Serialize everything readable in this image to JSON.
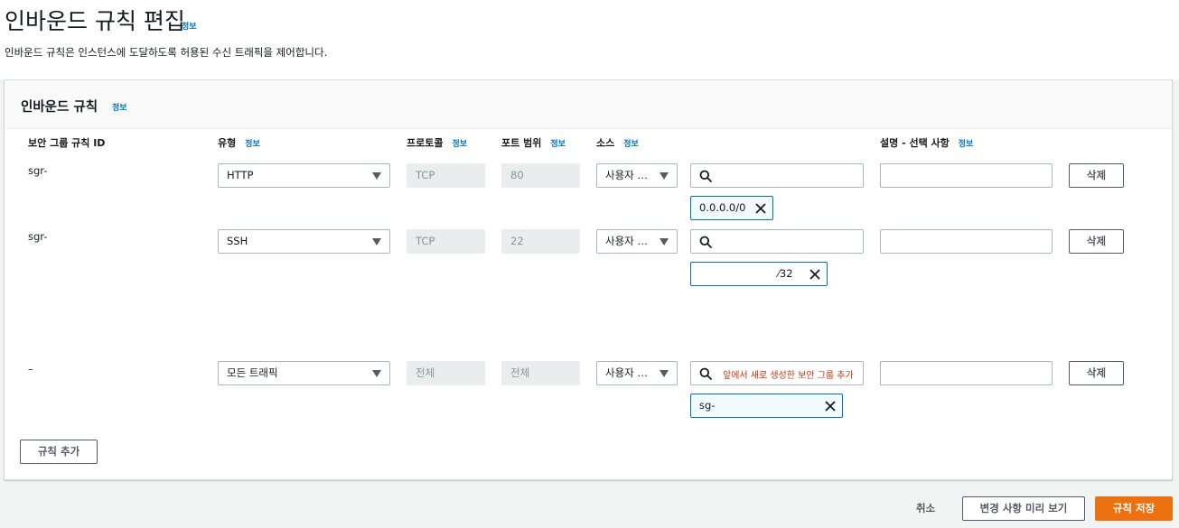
{
  "header": {
    "title": "인바운드 규칙 편집",
    "title_info": "정보",
    "description": "인바운드 규칙은 인스턴스에 도달하도록 허용된 수신 트래픽을 제어합니다."
  },
  "panel": {
    "title": "인바운드 규칙",
    "title_info": "정보",
    "columns": {
      "rule_id": "보안 그룹 규칙 ID",
      "type": "유형",
      "protocol": "프로토콜",
      "port_range": "포트 범위",
      "source": "소스",
      "description": "설명 - 선택 사항",
      "info": "정보"
    },
    "rules": [
      {
        "id": "sgr-",
        "type": "HTTP",
        "protocol": "TCP",
        "port_range": "80",
        "source_type": "사용자 …",
        "search_placeholder": "",
        "token": "0.0.0.0/0",
        "description": "",
        "delete_label": "삭제"
      },
      {
        "id": "sgr-",
        "type": "SSH",
        "protocol": "TCP",
        "port_range": "22",
        "source_type": "사용자 …",
        "search_placeholder": "",
        "token": "⁄32",
        "description": "",
        "delete_label": "삭제"
      },
      {
        "id": "–",
        "type": "모든 트래픽",
        "protocol": "전체",
        "port_range": "전체",
        "source_type": "사용자 …",
        "search_placeholder": "앞에서 새로 생성한 보안 그룹 추가",
        "token": "sg-",
        "description": "",
        "delete_label": "삭제"
      }
    ],
    "add_rule_label": "규칙 추가"
  },
  "footer": {
    "cancel_label": "취소",
    "preview_label": "변경 사항 미리 보기",
    "save_label": "규칙 저장"
  },
  "colors": {
    "accent_orange": "#ec7211",
    "info_blue": "#0073bb",
    "token_border": "#0073bb",
    "hint_red": "#d13212"
  }
}
